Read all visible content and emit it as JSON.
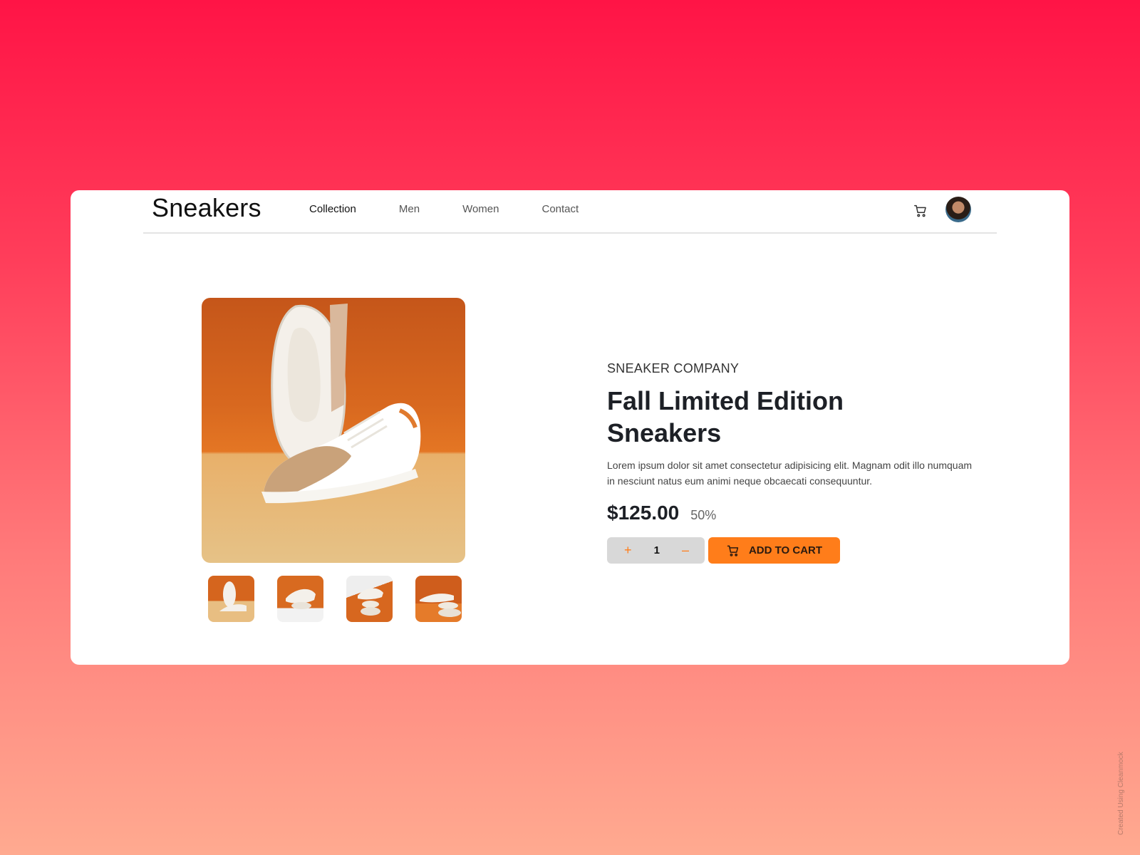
{
  "header": {
    "brand": "Sneakers",
    "nav": [
      "Collection",
      "Men",
      "Women",
      "Contact"
    ],
    "cart_icon": "cart-icon",
    "avatar_icon": "user-avatar"
  },
  "product": {
    "company": "SNEAKER COMPANY",
    "title": "Fall Limited Edition Sneakers",
    "description": "Lorem ipsum dolor sit amet consectetur adipisicing elit. Magnam odit illo numquam in nesciunt natus eum animi neque obcaecati consequuntur.",
    "price": "$125.00",
    "discount": "50%",
    "quantity": "1",
    "plus": "+",
    "minus": "–",
    "add_to_cart": "ADD TO CART"
  },
  "colors": {
    "accent": "#ff7d1a",
    "title": "#1d2026",
    "card_bg": "#ffffff"
  },
  "watermark": "Created Using Cleanmock"
}
